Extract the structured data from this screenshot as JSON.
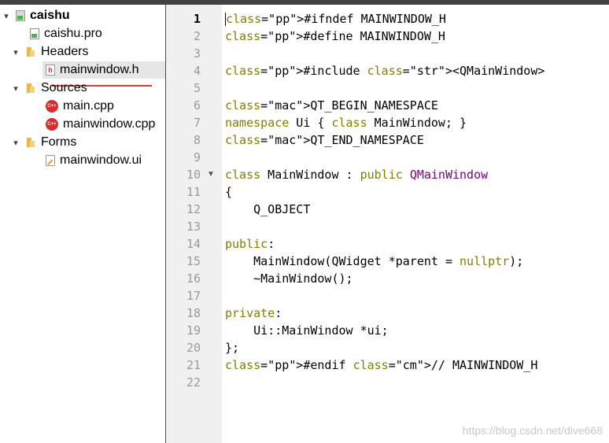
{
  "project_tree": {
    "root": "caishu",
    "project_file": "caishu.pro",
    "groups": [
      {
        "label": "Headers",
        "files": [
          "mainwindow.h"
        ]
      },
      {
        "label": "Sources",
        "files": [
          "main.cpp",
          "mainwindow.cpp"
        ]
      },
      {
        "label": "Forms",
        "files": [
          "mainwindow.ui"
        ]
      }
    ],
    "selected_file": "mainwindow.h"
  },
  "editor": {
    "current_line": 1,
    "lines": [
      "#ifndef MAINWINDOW_H",
      "#define MAINWINDOW_H",
      "",
      "#include <QMainWindow>",
      "",
      "QT_BEGIN_NAMESPACE",
      "namespace Ui { class MainWindow; }",
      "QT_END_NAMESPACE",
      "",
      "class MainWindow : public QMainWindow",
      "{",
      "    Q_OBJECT",
      "",
      "public:",
      "    MainWindow(QWidget *parent = nullptr);",
      "    ~MainWindow();",
      "",
      "private:",
      "    Ui::MainWindow *ui;",
      "};",
      "#endif // MAINWINDOW_H",
      ""
    ],
    "line_numbers": [
      "1",
      "2",
      "3",
      "4",
      "5",
      "6",
      "7",
      "8",
      "9",
      "10",
      "11",
      "12",
      "13",
      "14",
      "15",
      "16",
      "17",
      "18",
      "19",
      "20",
      "21",
      "22"
    ]
  },
  "watermark": "https://blog.csdn.net/dive668",
  "colors": {
    "preprocessor": "#000080",
    "keyword": "#808000",
    "macro": "#800080",
    "string": "#008000",
    "comment": "#008000"
  }
}
